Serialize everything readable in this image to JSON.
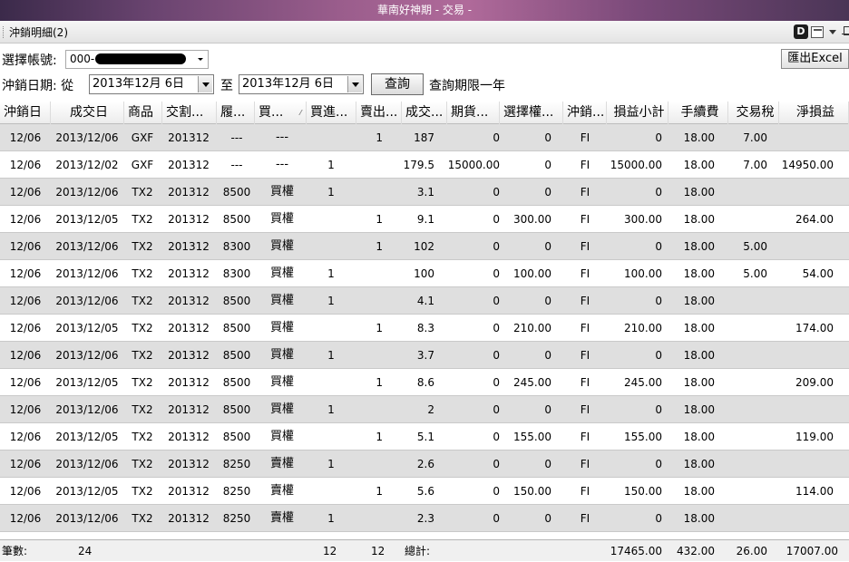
{
  "window": {
    "title": "華南好神期 - 交易 -"
  },
  "tab": {
    "title": "沖銷明細(2)"
  },
  "account": {
    "label": "選擇帳號:",
    "value_prefix": "000-"
  },
  "export": {
    "label": "匯出Excel"
  },
  "date_filter": {
    "label": "沖銷日期: 從",
    "from": "2013年12月  6日",
    "to_label": "至",
    "to": "2013年12月  6日",
    "query_label": "查詢",
    "note": "查詢期限一年"
  },
  "columns": [
    "沖銷日",
    "成交日",
    "商品",
    "交割...",
    "履...",
    "買...",
    "買進...",
    "賣出...",
    "成交...",
    "期貨...",
    "選擇權...",
    "沖銷...",
    "損益小計",
    "手續費",
    "交易稅",
    "淨損益"
  ],
  "rows": [
    [
      "12/06",
      "2013/12/06",
      "GXF",
      "201312",
      "---",
      "---",
      "",
      "1",
      "187",
      "0",
      "0",
      "FI",
      "0",
      "18.00",
      "7.00",
      ""
    ],
    [
      "12/06",
      "2013/12/02",
      "GXF",
      "201312",
      "---",
      "---",
      "1",
      "",
      "179.5",
      "15000.00",
      "0",
      "FI",
      "15000.00",
      "18.00",
      "7.00",
      "14950.00"
    ],
    [
      "12/06",
      "2013/12/06",
      "TX2",
      "201312",
      "8500",
      "買權",
      "1",
      "",
      "3.1",
      "0",
      "0",
      "FI",
      "0",
      "18.00",
      "",
      ""
    ],
    [
      "12/06",
      "2013/12/05",
      "TX2",
      "201312",
      "8500",
      "買權",
      "",
      "1",
      "9.1",
      "0",
      "300.00",
      "FI",
      "300.00",
      "18.00",
      "",
      "264.00"
    ],
    [
      "12/06",
      "2013/12/06",
      "TX2",
      "201312",
      "8300",
      "買權",
      "",
      "1",
      "102",
      "0",
      "0",
      "FI",
      "0",
      "18.00",
      "5.00",
      ""
    ],
    [
      "12/06",
      "2013/12/06",
      "TX2",
      "201312",
      "8300",
      "買權",
      "1",
      "",
      "100",
      "0",
      "100.00",
      "FI",
      "100.00",
      "18.00",
      "5.00",
      "54.00"
    ],
    [
      "12/06",
      "2013/12/06",
      "TX2",
      "201312",
      "8500",
      "買權",
      "1",
      "",
      "4.1",
      "0",
      "0",
      "FI",
      "0",
      "18.00",
      "",
      ""
    ],
    [
      "12/06",
      "2013/12/05",
      "TX2",
      "201312",
      "8500",
      "買權",
      "",
      "1",
      "8.3",
      "0",
      "210.00",
      "FI",
      "210.00",
      "18.00",
      "",
      "174.00"
    ],
    [
      "12/06",
      "2013/12/06",
      "TX2",
      "201312",
      "8500",
      "買權",
      "1",
      "",
      "3.7",
      "0",
      "0",
      "FI",
      "0",
      "18.00",
      "",
      ""
    ],
    [
      "12/06",
      "2013/12/05",
      "TX2",
      "201312",
      "8500",
      "買權",
      "",
      "1",
      "8.6",
      "0",
      "245.00",
      "FI",
      "245.00",
      "18.00",
      "",
      "209.00"
    ],
    [
      "12/06",
      "2013/12/06",
      "TX2",
      "201312",
      "8500",
      "買權",
      "1",
      "",
      "2",
      "0",
      "0",
      "FI",
      "0",
      "18.00",
      "",
      ""
    ],
    [
      "12/06",
      "2013/12/05",
      "TX2",
      "201312",
      "8500",
      "買權",
      "",
      "1",
      "5.1",
      "0",
      "155.00",
      "FI",
      "155.00",
      "18.00",
      "",
      "119.00"
    ],
    [
      "12/06",
      "2013/12/06",
      "TX2",
      "201312",
      "8250",
      "賣權",
      "1",
      "",
      "2.6",
      "0",
      "0",
      "FI",
      "0",
      "18.00",
      "",
      ""
    ],
    [
      "12/06",
      "2013/12/05",
      "TX2",
      "201312",
      "8250",
      "賣權",
      "",
      "1",
      "5.6",
      "0",
      "150.00",
      "FI",
      "150.00",
      "18.00",
      "",
      "114.00"
    ],
    [
      "12/06",
      "2013/12/06",
      "TX2",
      "201312",
      "8250",
      "賣權",
      "1",
      "",
      "2.3",
      "0",
      "0",
      "FI",
      "0",
      "18.00",
      "",
      ""
    ]
  ],
  "footer": {
    "count_label": "筆數:",
    "count": "24",
    "buy_total": "12",
    "sell_total": "12",
    "total_label": "總計:",
    "pnl_total": "17465.00",
    "fee_total": "432.00",
    "tax_total": "26.00",
    "net_total": "17007.00"
  }
}
